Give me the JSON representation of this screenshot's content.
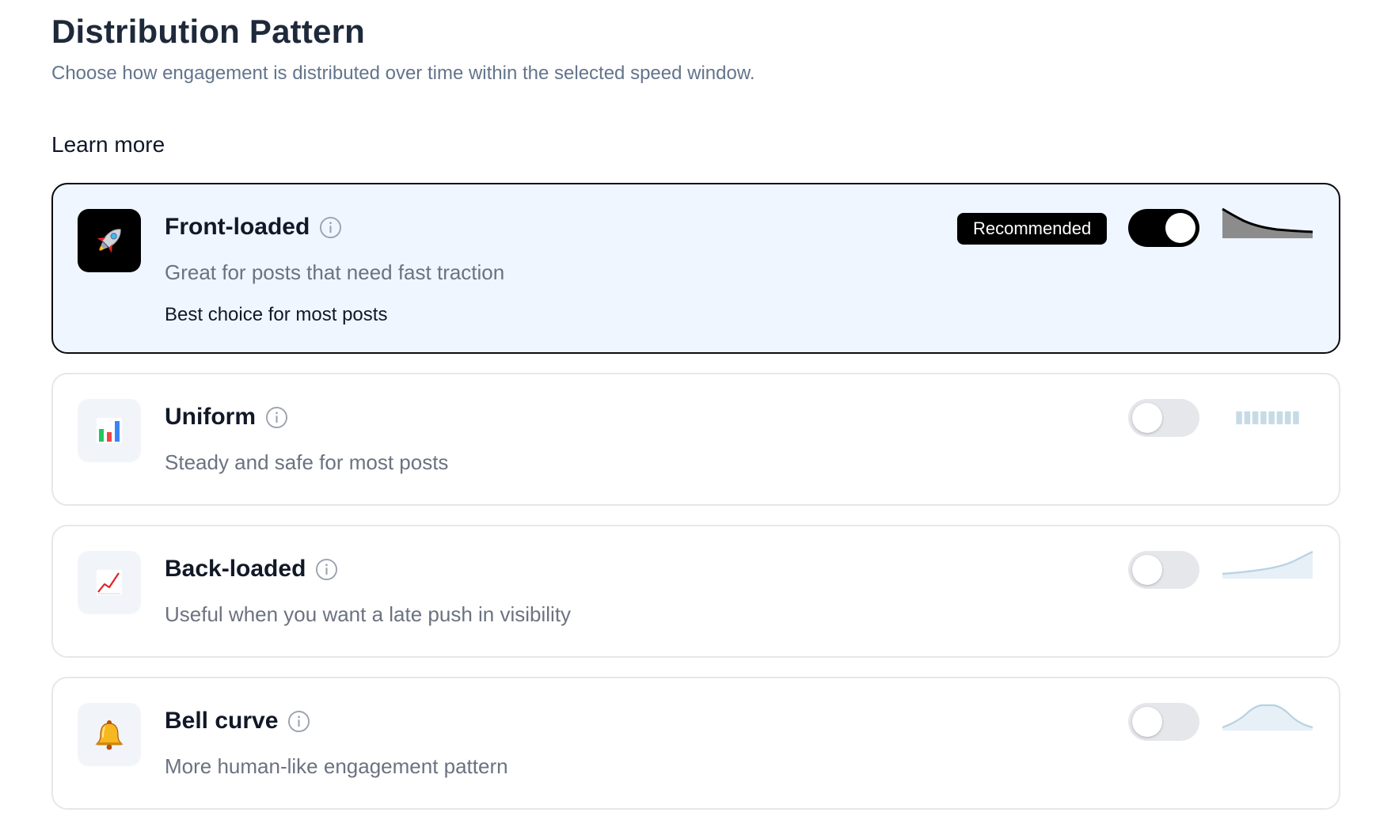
{
  "header": {
    "title": "Distribution Pattern",
    "subtitle": "Choose how engagement is distributed over time within the selected speed window."
  },
  "learn_more_label": "Learn more",
  "options": [
    {
      "title": "Front-loaded",
      "description": "Great for posts that need fast traction",
      "note": "Best choice for most posts",
      "badge": "Recommended",
      "icon": "rocket-icon",
      "selected": true
    },
    {
      "title": "Uniform",
      "description": "Steady and safe for most posts",
      "icon": "bar-chart-icon",
      "selected": false
    },
    {
      "title": "Back-loaded",
      "description": "Useful when you want a late push in visibility",
      "icon": "chart-increasing-icon",
      "selected": false
    },
    {
      "title": "Bell curve",
      "description": "More human-like engagement pattern",
      "icon": "bell-icon",
      "selected": false
    }
  ],
  "colors": {
    "selected_card_bg": "#eff6ff",
    "selected_border": "#0b0b0b",
    "toggle_on": "#000000",
    "toggle_off": "#e5e7eb",
    "spark_inactive": "#c7dbe6"
  }
}
